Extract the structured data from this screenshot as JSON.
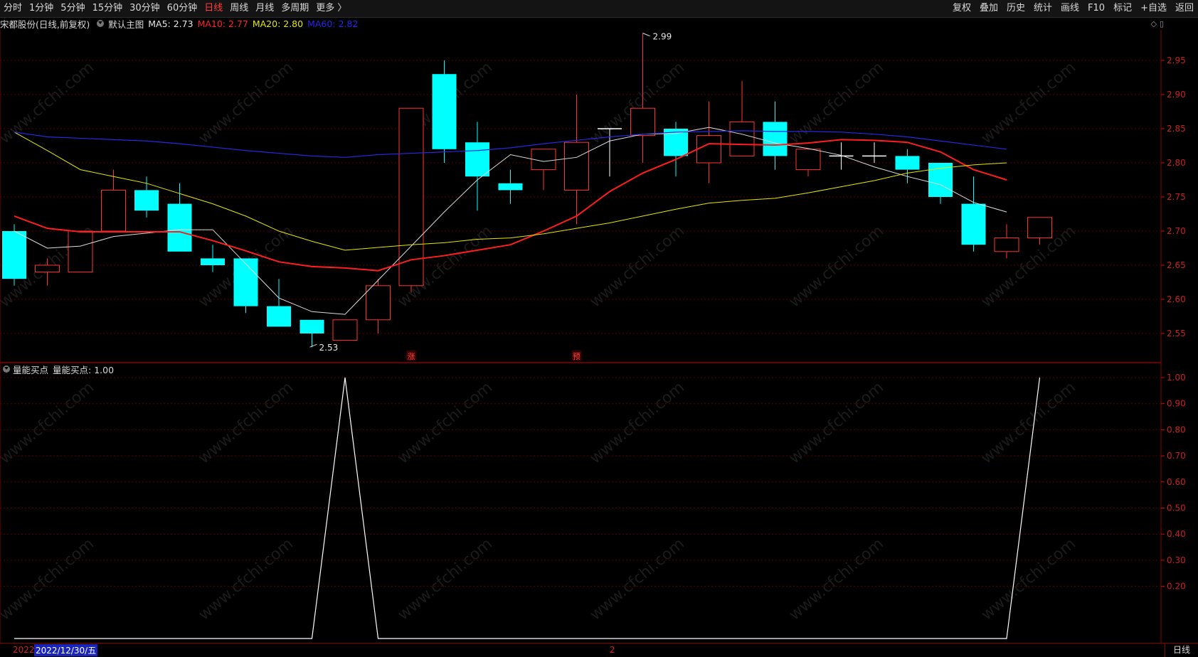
{
  "toolbar": {
    "left_items": [
      "分时",
      "1分钟",
      "5分钟",
      "15分钟",
      "30分钟",
      "60分钟",
      "日线",
      "周线",
      "月线",
      "多周期",
      "更多 〉"
    ],
    "active_index": 6,
    "right_items": [
      "复权",
      "叠加",
      "历史",
      "统计",
      "画线",
      "F10",
      "标记",
      "+自选",
      "返回"
    ]
  },
  "info": {
    "stock": "宋都股份(日线,前复权)",
    "main_chart": "默认主图",
    "ma5": "MA5: 2.73",
    "ma10": "MA10: 2.77",
    "ma20": "MA20: 2.80",
    "ma60": "MA60: 2.82",
    "colors": {
      "ma5": "#e6e6e6",
      "ma10": "#ff2020",
      "ma20": "#e6e600",
      "ma60": "#2020e6"
    }
  },
  "indicator": {
    "name": "量能买点",
    "value_text": "量能买点: 1.00"
  },
  "annotations": {
    "high_label": "2.99",
    "low_label": "2.53",
    "marker_zhang": "涨",
    "marker_yu": "预"
  },
  "bottom": {
    "date_start": "2022",
    "date_cursor": "2022/12/30/五",
    "date_mid": "2",
    "period": "日线"
  },
  "watermark": "www.cfchi.com",
  "chart_data": [
    {
      "type": "candlestick",
      "title": "",
      "ylim": [
        2.52,
        3.01
      ],
      "yticks": [
        "2.95",
        "2.90",
        "2.85",
        "2.80",
        "2.75",
        "2.70",
        "2.65",
        "2.60",
        "2.55"
      ],
      "candles": [
        {
          "o": 2.7,
          "h": 2.71,
          "l": 2.62,
          "c": 2.63
        },
        {
          "o": 2.64,
          "h": 2.66,
          "l": 2.62,
          "c": 2.65
        },
        {
          "o": 2.64,
          "h": 2.7,
          "l": 2.64,
          "c": 2.7
        },
        {
          "o": 2.7,
          "h": 2.79,
          "l": 2.7,
          "c": 2.76
        },
        {
          "o": 2.76,
          "h": 2.78,
          "l": 2.72,
          "c": 2.73
        },
        {
          "o": 2.74,
          "h": 2.77,
          "l": 2.67,
          "c": 2.67
        },
        {
          "o": 2.66,
          "h": 2.68,
          "l": 2.64,
          "c": 2.65
        },
        {
          "o": 2.66,
          "h": 2.66,
          "l": 2.58,
          "c": 2.59
        },
        {
          "o": 2.59,
          "h": 2.63,
          "l": 2.56,
          "c": 2.56
        },
        {
          "o": 2.57,
          "h": 2.57,
          "l": 2.53,
          "c": 2.55
        },
        {
          "o": 2.54,
          "h": 2.57,
          "l": 2.54,
          "c": 2.57
        },
        {
          "o": 2.57,
          "h": 2.63,
          "l": 2.55,
          "c": 2.62
        },
        {
          "o": 2.62,
          "h": 2.88,
          "l": 2.61,
          "c": 2.88
        },
        {
          "o": 2.93,
          "h": 2.95,
          "l": 2.8,
          "c": 2.82
        },
        {
          "o": 2.83,
          "h": 2.86,
          "l": 2.73,
          "c": 2.78
        },
        {
          "o": 2.77,
          "h": 2.79,
          "l": 2.74,
          "c": 2.76
        },
        {
          "o": 2.79,
          "h": 2.82,
          "l": 2.76,
          "c": 2.82
        },
        {
          "o": 2.76,
          "h": 2.9,
          "l": 2.71,
          "c": 2.83
        },
        {
          "o": 2.85,
          "h": 2.85,
          "l": 2.78,
          "c": 2.85
        },
        {
          "o": 2.84,
          "h": 2.99,
          "l": 2.8,
          "c": 2.88
        },
        {
          "o": 2.85,
          "h": 2.86,
          "l": 2.78,
          "c": 2.81
        },
        {
          "o": 2.8,
          "h": 2.89,
          "l": 2.77,
          "c": 2.84
        },
        {
          "o": 2.81,
          "h": 2.92,
          "l": 2.81,
          "c": 2.86
        },
        {
          "o": 2.86,
          "h": 2.89,
          "l": 2.79,
          "c": 2.81
        },
        {
          "o": 2.79,
          "h": 2.82,
          "l": 2.78,
          "c": 2.82
        },
        {
          "o": 2.81,
          "h": 2.83,
          "l": 2.79,
          "c": 2.81
        },
        {
          "o": 2.81,
          "h": 2.83,
          "l": 2.8,
          "c": 2.81
        },
        {
          "o": 2.81,
          "h": 2.82,
          "l": 2.77,
          "c": 2.79
        },
        {
          "o": 2.8,
          "h": 2.8,
          "l": 2.74,
          "c": 2.75
        },
        {
          "o": 2.74,
          "h": 2.78,
          "l": 2.67,
          "c": 2.68
        },
        {
          "o": 2.67,
          "h": 2.71,
          "l": 2.66,
          "c": 2.69
        },
        {
          "o": 2.69,
          "h": 2.72,
          "l": 2.68,
          "c": 2.72
        }
      ],
      "ma_lines": {
        "MA5": [
          2.7,
          2.675,
          2.678,
          2.692,
          2.697,
          2.702,
          2.702,
          2.652,
          2.602,
          2.582,
          2.578,
          2.628,
          2.678,
          2.728,
          2.775,
          2.812,
          2.802,
          2.808,
          2.832,
          2.842,
          2.843,
          2.852,
          2.842,
          2.829,
          2.821,
          2.811,
          2.794,
          2.78,
          2.768,
          2.742,
          2.728
        ],
        "MA10": [
          2.722,
          2.704,
          2.699,
          2.699,
          2.699,
          2.699,
          2.686,
          2.671,
          2.655,
          2.648,
          2.646,
          2.642,
          2.658,
          2.664,
          2.672,
          2.68,
          2.7,
          2.722,
          2.758,
          2.785,
          2.805,
          2.828,
          2.827,
          2.826,
          2.829,
          2.834,
          2.833,
          2.83,
          2.816,
          2.79,
          2.775
        ],
        "MA20": [
          2.845,
          2.818,
          2.79,
          2.78,
          2.77,
          2.755,
          2.74,
          2.722,
          2.7,
          2.685,
          2.672,
          2.676,
          2.68,
          2.683,
          2.688,
          2.69,
          2.696,
          2.704,
          2.712,
          2.722,
          2.732,
          2.741,
          2.745,
          2.748,
          2.756,
          2.765,
          2.774,
          2.785,
          2.792,
          2.797,
          2.8
        ],
        "MA60": [
          2.845,
          2.838,
          2.836,
          2.834,
          2.832,
          2.828,
          2.823,
          2.818,
          2.814,
          2.81,
          2.808,
          2.812,
          2.814,
          2.816,
          2.818,
          2.822,
          2.828,
          2.833,
          2.838,
          2.842,
          2.845,
          2.846,
          2.847,
          2.846,
          2.846,
          2.845,
          2.842,
          2.838,
          2.832,
          2.826,
          2.82
        ]
      }
    },
    {
      "type": "line",
      "title": "",
      "ylim": [
        0,
        1.05
      ],
      "yticks": [
        "1.00",
        "0.90",
        "0.80",
        "0.70",
        "0.60",
        "0.50",
        "0.40",
        "0.30",
        "0.20"
      ],
      "x": [
        0,
        9,
        10,
        11,
        30,
        31
      ],
      "values": [
        0,
        0,
        1,
        0,
        0,
        1
      ]
    }
  ]
}
